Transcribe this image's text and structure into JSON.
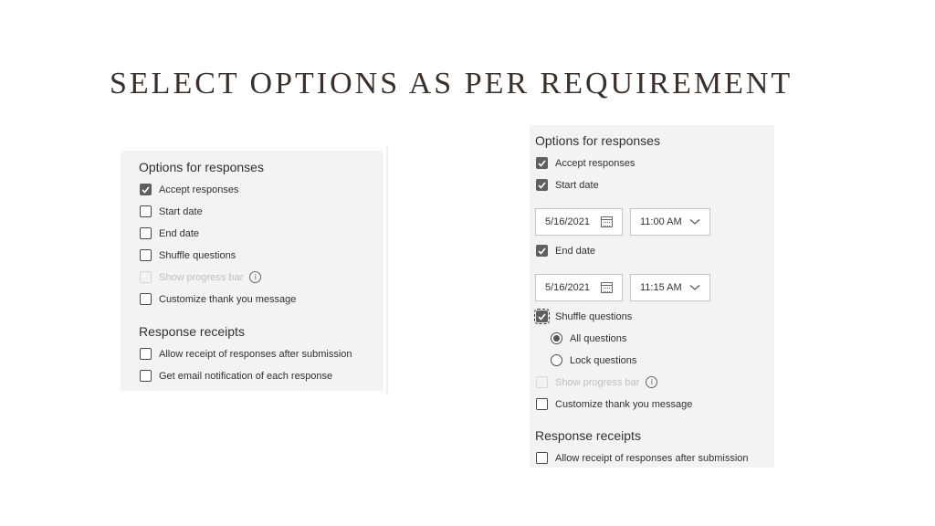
{
  "slide": {
    "title": "SELECT OPTIONS AS PER REQUIREMENT"
  },
  "left_panel": {
    "options_title": "Options for responses",
    "options": [
      {
        "label": "Accept responses",
        "checked": true
      },
      {
        "label": "Start date",
        "checked": false
      },
      {
        "label": "End date",
        "checked": false
      },
      {
        "label": "Shuffle questions",
        "checked": false
      },
      {
        "label": "Show progress bar",
        "checked": false,
        "disabled": true
      },
      {
        "label": "Customize thank you message",
        "checked": false
      }
    ],
    "receipts_title": "Response receipts",
    "receipts": [
      {
        "label": "Allow receipt of responses after submission",
        "checked": false
      },
      {
        "label": "Get email notification of each response",
        "checked": false
      }
    ]
  },
  "right_panel": {
    "options_title": "Options for responses",
    "accept_responses": {
      "label": "Accept responses",
      "checked": true
    },
    "start_date": {
      "label": "Start date",
      "checked": true,
      "date": "5/16/2021",
      "time": "11:00 AM"
    },
    "end_date": {
      "label": "End date",
      "checked": true,
      "date": "5/16/2021",
      "time": "11:15 AM"
    },
    "shuffle": {
      "label": "Shuffle questions",
      "checked": true,
      "options": [
        "All questions",
        "Lock questions"
      ],
      "selected": "All questions"
    },
    "progress_bar": {
      "label": "Show progress bar",
      "checked": false,
      "disabled": true
    },
    "thank_you": {
      "label": "Customize thank you message",
      "checked": false
    },
    "receipts_title": "Response receipts",
    "receipts": [
      {
        "label": "Allow receipt of responses after submission",
        "checked": false
      }
    ]
  },
  "icons": {
    "info": "i"
  }
}
